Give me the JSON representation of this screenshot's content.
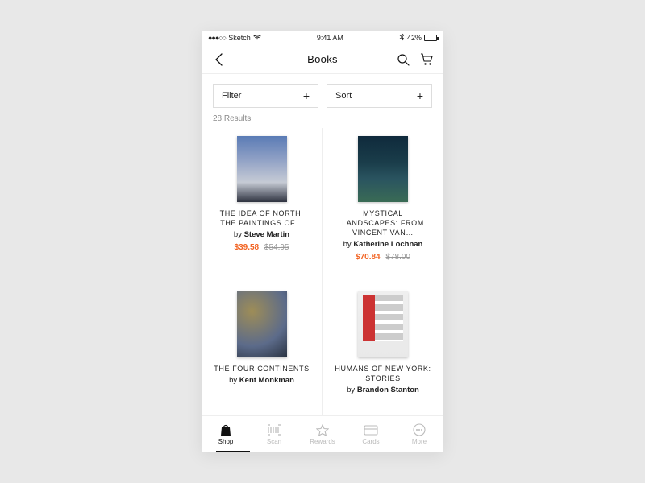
{
  "statusbar": {
    "carrier": "Sketch",
    "time": "9:41 AM",
    "battery_pct": "42%"
  },
  "nav": {
    "title": "Books"
  },
  "controls": {
    "filter_label": "Filter",
    "sort_label": "Sort"
  },
  "results_count": "28 Results",
  "products": [
    {
      "title": "THE IDEA OF NORTH: THE PAINTINGS OF…",
      "author_prefix": "by ",
      "author": "Steve Martin",
      "price": "$39.58",
      "old_price": "$54.95"
    },
    {
      "title": "MYSTICAL LANDSCAPES: FROM VINCENT VAN…",
      "author_prefix": "by ",
      "author": "Katherine Lochnan",
      "price": "$70.84",
      "old_price": "$78.00"
    },
    {
      "title": "THE FOUR CONTINENTS",
      "author_prefix": "by ",
      "author": "Kent Monkman",
      "price": "",
      "old_price": ""
    },
    {
      "title": "HUMANS OF NEW YORK: STORIES",
      "author_prefix": "by ",
      "author": "Brandon Stanton",
      "price": "",
      "old_price": ""
    }
  ],
  "tabs": [
    {
      "label": "Shop"
    },
    {
      "label": "Scan"
    },
    {
      "label": "Rewards"
    },
    {
      "label": "Cards"
    },
    {
      "label": "More"
    }
  ]
}
